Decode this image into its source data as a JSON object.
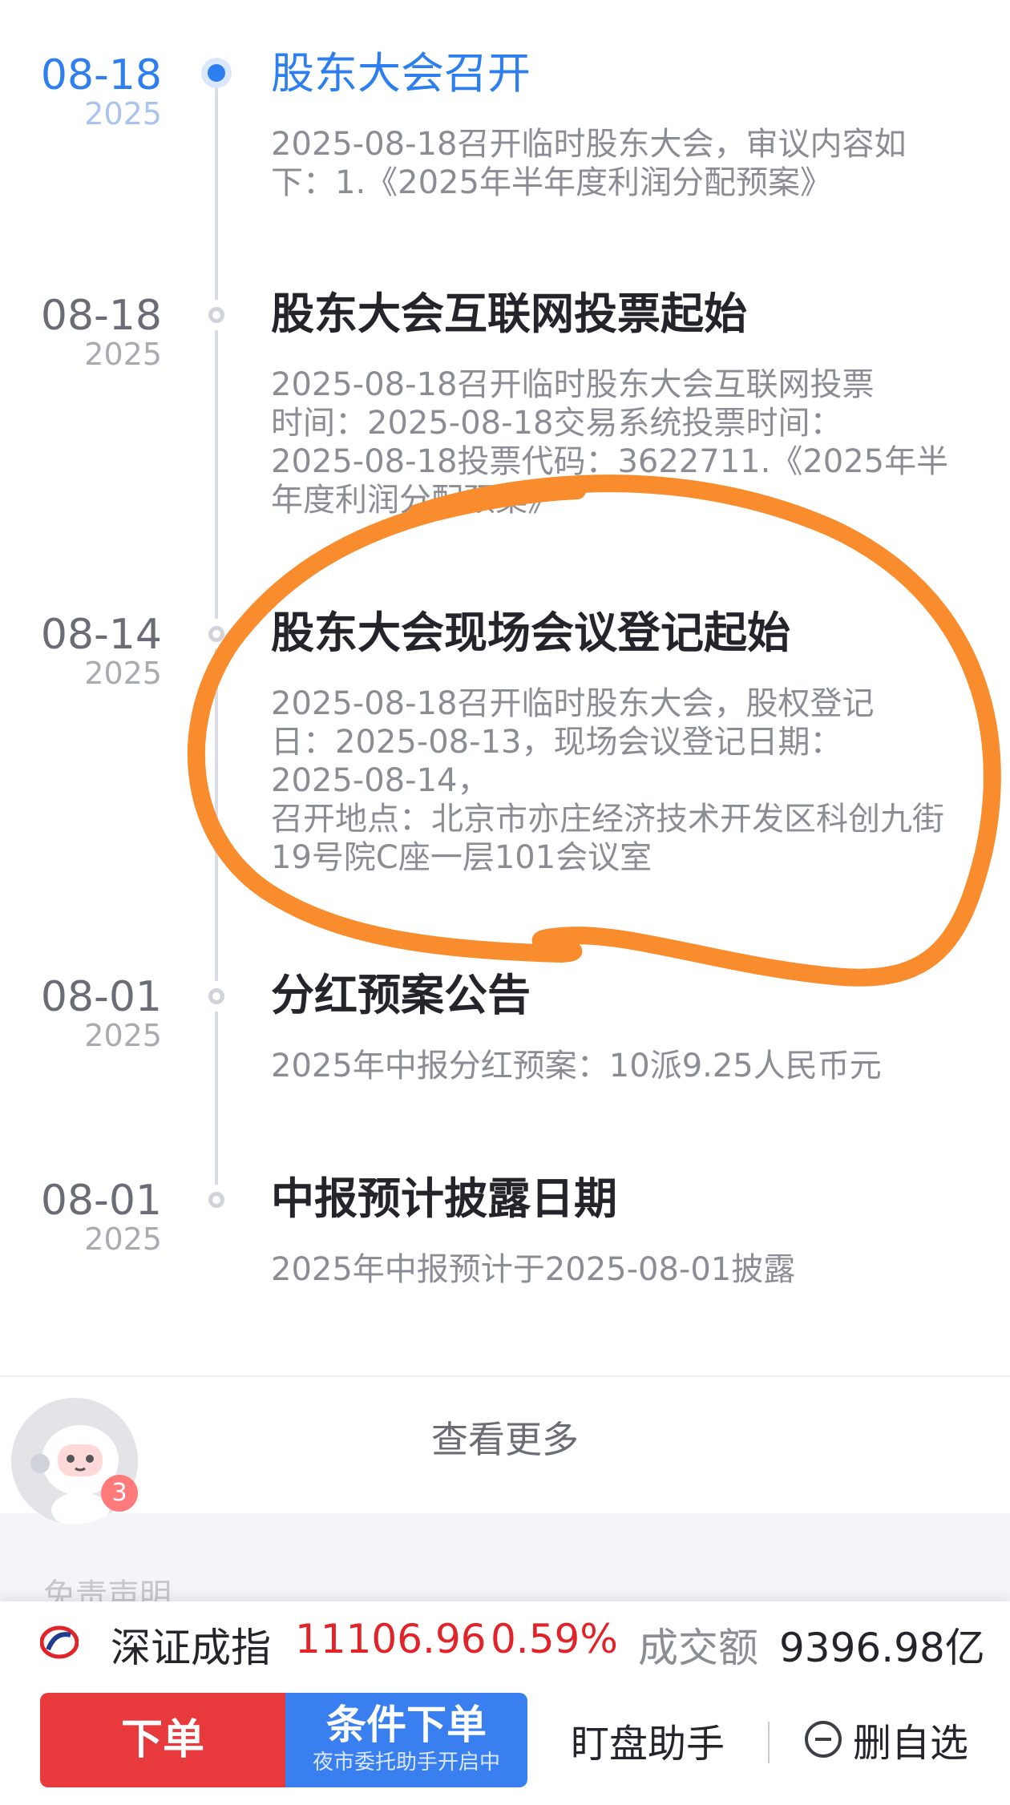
{
  "events": [
    {
      "date": "08-18",
      "year": "2025",
      "title": "股东大会召开",
      "desc": "2025-08-18召开临时股东大会，审议内容如\n下：1.《2025年半年度利润分配预案》"
    },
    {
      "date": "08-18",
      "year": "2025",
      "title": "股东大会互联网投票起始",
      "desc": "2025-08-18召开临时股东大会互联网投票\n时间：2025-08-18交易系统投票时间：\n2025-08-18投票代码：3622711.《2025年半\n年度利润分配预案》"
    },
    {
      "date": "08-14",
      "year": "2025",
      "title": "股东大会现场会议登记起始",
      "desc": "2025-08-18召开临时股东大会，股权登记\n日：2025-08-13，现场会议登记日期：\n2025-08-14，\n召开地点：北京市亦庄经济技术开发区科创九街\n19号院C座一层101会议室"
    },
    {
      "date": "08-01",
      "year": "2025",
      "title": "分红预案公告",
      "desc": "2025年中报分红预案：10派9.25人民币元"
    },
    {
      "date": "08-01",
      "year": "2025",
      "title": "中报预计披露日期",
      "desc": "2025年中报预计于2025-08-01披露"
    }
  ],
  "see_more": "查看更多",
  "disclaimer": "免责声明",
  "avatar_badge": "3",
  "ticker": {
    "name": "深证成指",
    "value": "11106.96",
    "change": "0.59%",
    "volume_label": "成交额",
    "volume_value": "9396.98亿"
  },
  "actions": {
    "order_label": "下单",
    "conditional_label": "条件下单",
    "conditional_sub": "夜市委托助手开启中",
    "watch_label": "盯盘助手",
    "remove_label": "删自选"
  },
  "colors": {
    "accent_blue": "#2d7ff0",
    "up_red": "#e0242a",
    "order_red": "#e8393c",
    "annotation_orange": "#f98c2d"
  }
}
